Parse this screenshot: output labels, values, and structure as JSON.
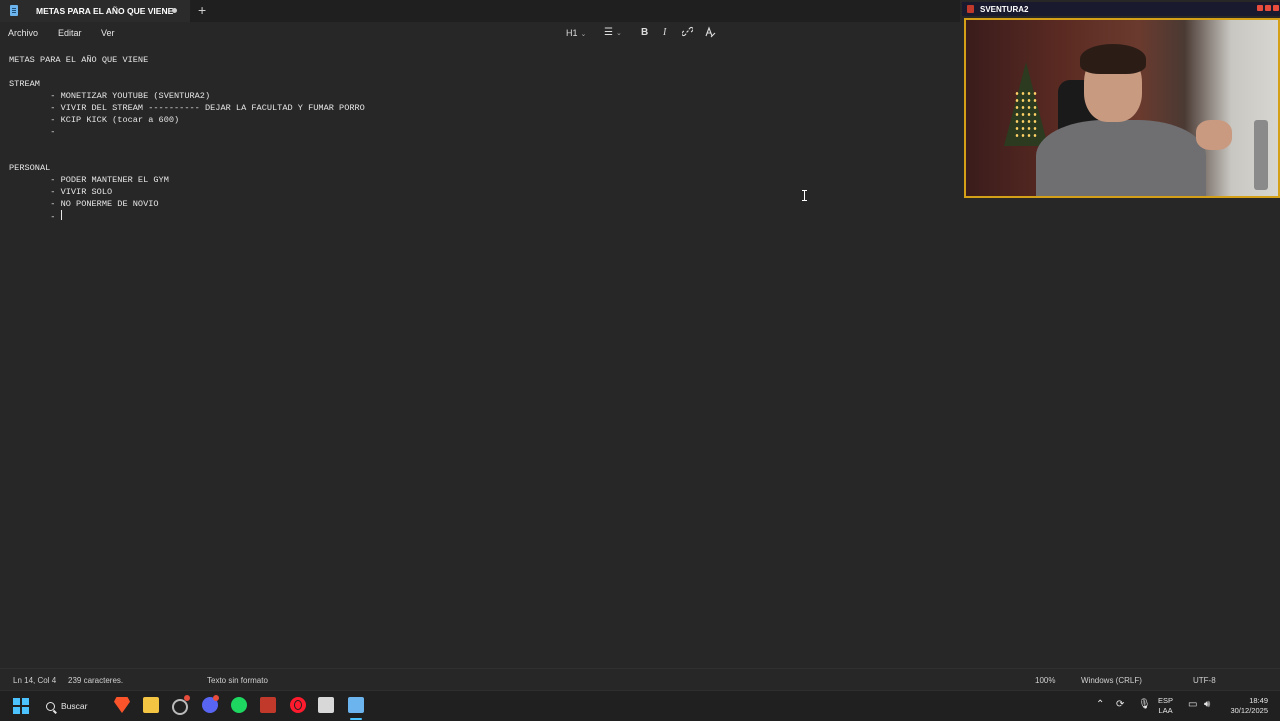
{
  "window": {
    "tab_title": "METAS PARA EL AÑO QUE VIENE",
    "new_tab_symbol": "+"
  },
  "menu": {
    "file": "Archivo",
    "edit": "Editar",
    "view": "Ver"
  },
  "toolbar": {
    "heading": "H1",
    "bold": "B",
    "italic": "I"
  },
  "document": {
    "lines": [
      "METAS PARA EL AÑO QUE VIENE",
      "",
      "STREAM",
      "        - MONETIZAR YOUTUBE (SVENTURA2)",
      "        - VIVIR DEL STREAM ---------- DEJAR LA FACULTAD Y FUMAR PORRO",
      "        - KCIP KICK (tocar a 600)",
      "        -",
      "",
      "",
      "PERSONAL",
      "        - PODER MANTENER EL GYM",
      "        - VIVIR SOLO",
      "        - NO PONERME DE NOVIO",
      "        - "
    ]
  },
  "webcam": {
    "channel_name": "SVENTURA2"
  },
  "status": {
    "position": "Ln 14, Col 4",
    "chars": "239 caracteres.",
    "format": "Texto sin formato",
    "zoom": "100%",
    "line_ending": "Windows (CRLF)",
    "encoding": "UTF-8"
  },
  "taskbar": {
    "search_label": "Buscar",
    "lang_top": "ESP",
    "lang_bottom": "LAA",
    "time": "18:49",
    "date": "30/12/2025",
    "accent": "#4cc2ff"
  }
}
